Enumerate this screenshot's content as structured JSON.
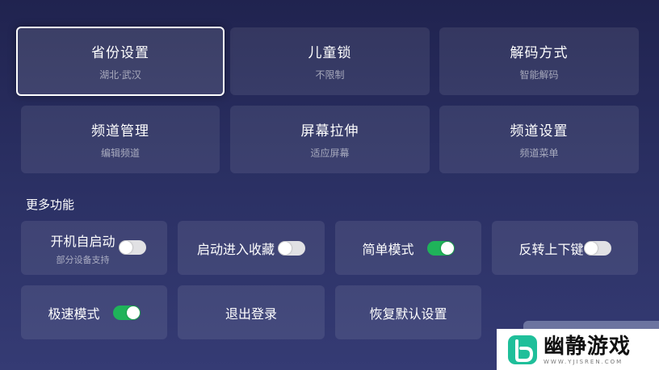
{
  "settings_grid": [
    {
      "title": "省份设置",
      "subtitle": "湖北·武汉"
    },
    {
      "title": "儿童锁",
      "subtitle": "不限制"
    },
    {
      "title": "解码方式",
      "subtitle": "智能解码"
    },
    {
      "title": "频道管理",
      "subtitle": "编辑频道"
    },
    {
      "title": "屏幕拉伸",
      "subtitle": "适应屏幕"
    },
    {
      "title": "频道设置",
      "subtitle": "频道菜单"
    }
  ],
  "more_section": {
    "title": "更多功能",
    "items": [
      {
        "label": "开机自启动",
        "subtitle": "部分设备支持",
        "toggle": "off"
      },
      {
        "label": "启动进入收藏",
        "toggle": "off"
      },
      {
        "label": "简单模式",
        "toggle": "on"
      },
      {
        "label": "反转上下键",
        "toggle": "off"
      },
      {
        "label": "极速模式",
        "toggle": "on"
      },
      {
        "label": "退出登录"
      },
      {
        "label": "恢复默认设置"
      }
    ]
  },
  "watermark": {
    "name": "幽静游戏",
    "url": "WWW.YJISREN.COM"
  },
  "colors": {
    "background_top": "#20234f",
    "background_bottom": "#353b74",
    "toggle_on": "#1fb35a",
    "toggle_off": "#e1e1e4",
    "focus_border": "#ffffff"
  }
}
